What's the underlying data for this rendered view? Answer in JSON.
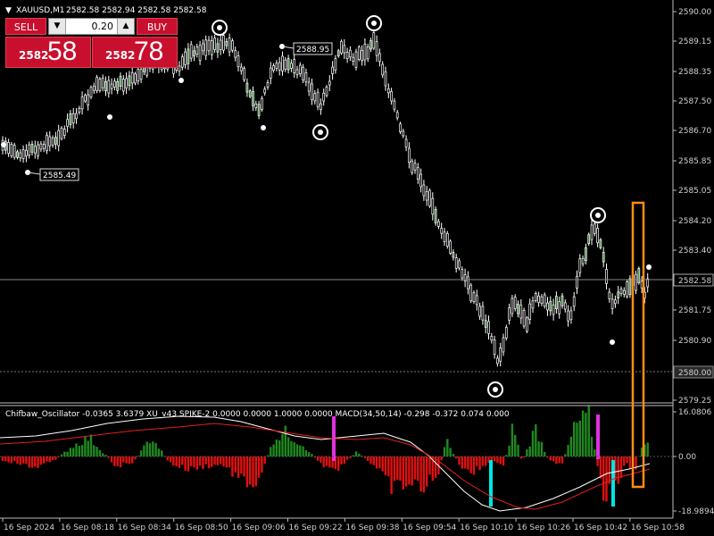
{
  "header": {
    "symbol": "XAUUSD,M1",
    "ohlc": "2582.58 2582.94 2582.58 2582.58",
    "indicator_line": "Chifbaw_Oscillator -0.0365 3.6379  XU_v43 SPIKE-2 0.0000 0.0000 1.0000 0.0000  MACD(34,50,14) -0.298 -0.372 0.074 0.000"
  },
  "trade_panel": {
    "sell_label": "SELL",
    "buy_label": "BUY",
    "lot_value": "0.20",
    "sell_price_small": "2582",
    "sell_price_big": "58",
    "buy_price_small": "2582",
    "buy_price_big": "78"
  },
  "price_axis": {
    "ticks": [
      "2590.00",
      "2589.15",
      "2588.35",
      "2587.50",
      "2586.70",
      "2585.85",
      "2585.05",
      "2584.20",
      "2583.40",
      "2582.58",
      "2581.75",
      "2580.90",
      "2580.00",
      "2579.25"
    ],
    "current_price": "2582.58",
    "dashed_level": "2580.00"
  },
  "sub_axis": {
    "top": "16.0806",
    "mid": "0.00",
    "bottom": "-18.9894"
  },
  "time_axis": [
    "16 Sep 2024",
    "16 Sep 08:18",
    "16 Sep 08:34",
    "16 Sep 08:50",
    "16 Sep 09:06",
    "16 Sep 09:22",
    "16 Sep 09:38",
    "16 Sep 09:54",
    "16 Sep 10:10",
    "16 Sep 10:26",
    "16 Sep 10:42",
    "16 Sep 10:58"
  ],
  "price_labels": [
    {
      "text": "2585.49",
      "price": 2585.49
    },
    {
      "text": "2588.95",
      "price": 2588.95
    }
  ],
  "colors": {
    "background": "#000000",
    "candle": "#ffffff",
    "hist_pos": "#1e8a1e",
    "hist_neg": "#e01010",
    "spike_magenta": "#e030e0",
    "spike_cyan": "#00e5e5",
    "signal_white": "#ffffff",
    "signal_red": "#e02020",
    "highlight_box": "#ff8c1a",
    "trade_red": "#c8102e"
  }
}
